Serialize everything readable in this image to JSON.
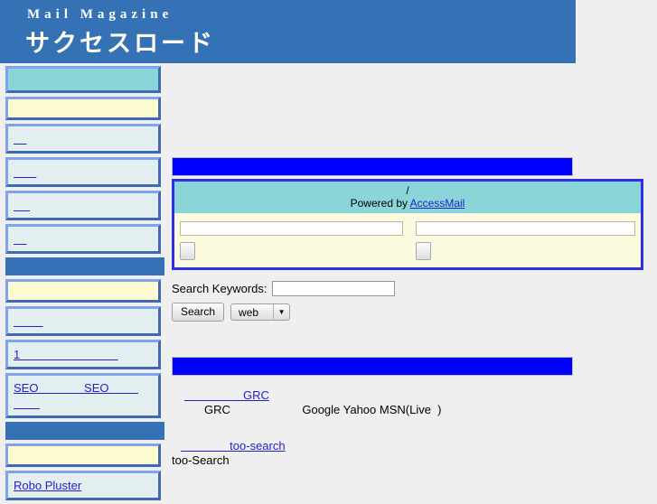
{
  "header": {
    "kicker": "Mail Magazine",
    "sitename": "サクセスロード",
    "bg_color": "#3572b5"
  },
  "sidebar": {
    "boxes": [
      {
        "style": "teal",
        "links": []
      },
      {
        "style": "cream",
        "links": []
      },
      {
        "style": "plain",
        "links": [
          "    "
        ]
      },
      {
        "style": "plain",
        "links": [
          "       "
        ]
      },
      {
        "style": "plain",
        "links": [
          "     "
        ]
      },
      {
        "style": "plain",
        "links": [
          "    "
        ]
      },
      {
        "style": "bar",
        "links": []
      },
      {
        "style": "cream",
        "links": []
      },
      {
        "style": "plain",
        "links": [
          "         "
        ]
      },
      {
        "style": "plain",
        "links": [
          "1                              "
        ]
      },
      {
        "style": "plain",
        "links": [
          "SEO              SEO         ",
          "        "
        ]
      },
      {
        "style": "bar",
        "links": []
      },
      {
        "style": "cream",
        "links": []
      },
      {
        "style": "plain",
        "links": [
          "Robo Pluster"
        ]
      }
    ],
    "colors": {
      "teal": "#8ad5d8",
      "cream": "#fdfbd0",
      "plain": "#e3eef0",
      "bar": "#3572b5",
      "border_light": "#7fa3ec",
      "border_dark": "#4069b4",
      "link": "#2222cc"
    }
  },
  "main": {
    "section_bar_1": "",
    "section_bar_2": "",
    "bar_color": "#0000ff",
    "subscribe_form": {
      "title_line1": "/",
      "powered_prefix": "Powered by ",
      "powered_link": "AccessMail",
      "left_input_value": "",
      "left_input_placeholder": "",
      "left_button_label": "",
      "right_input_value": "",
      "right_input_placeholder": "",
      "right_button_label": "",
      "border_color": "#2f2fe8",
      "head_bg": "#8ad5d8",
      "body_bg": "#fdfbdf"
    },
    "search": {
      "label": "Search Keywords:",
      "input_value": "",
      "input_placeholder": "",
      "button_label": "Search",
      "engine_selected": "web",
      "engine_options": [
        "web"
      ],
      "arrow_icon": "▼"
    },
    "tools": [
      {
        "link_text": "                  GRC",
        "desc": "GRC                      Google Yahoo MSN(Live  )"
      },
      {
        "link_text": "               too-search",
        "desc": "too-Search"
      }
    ]
  }
}
